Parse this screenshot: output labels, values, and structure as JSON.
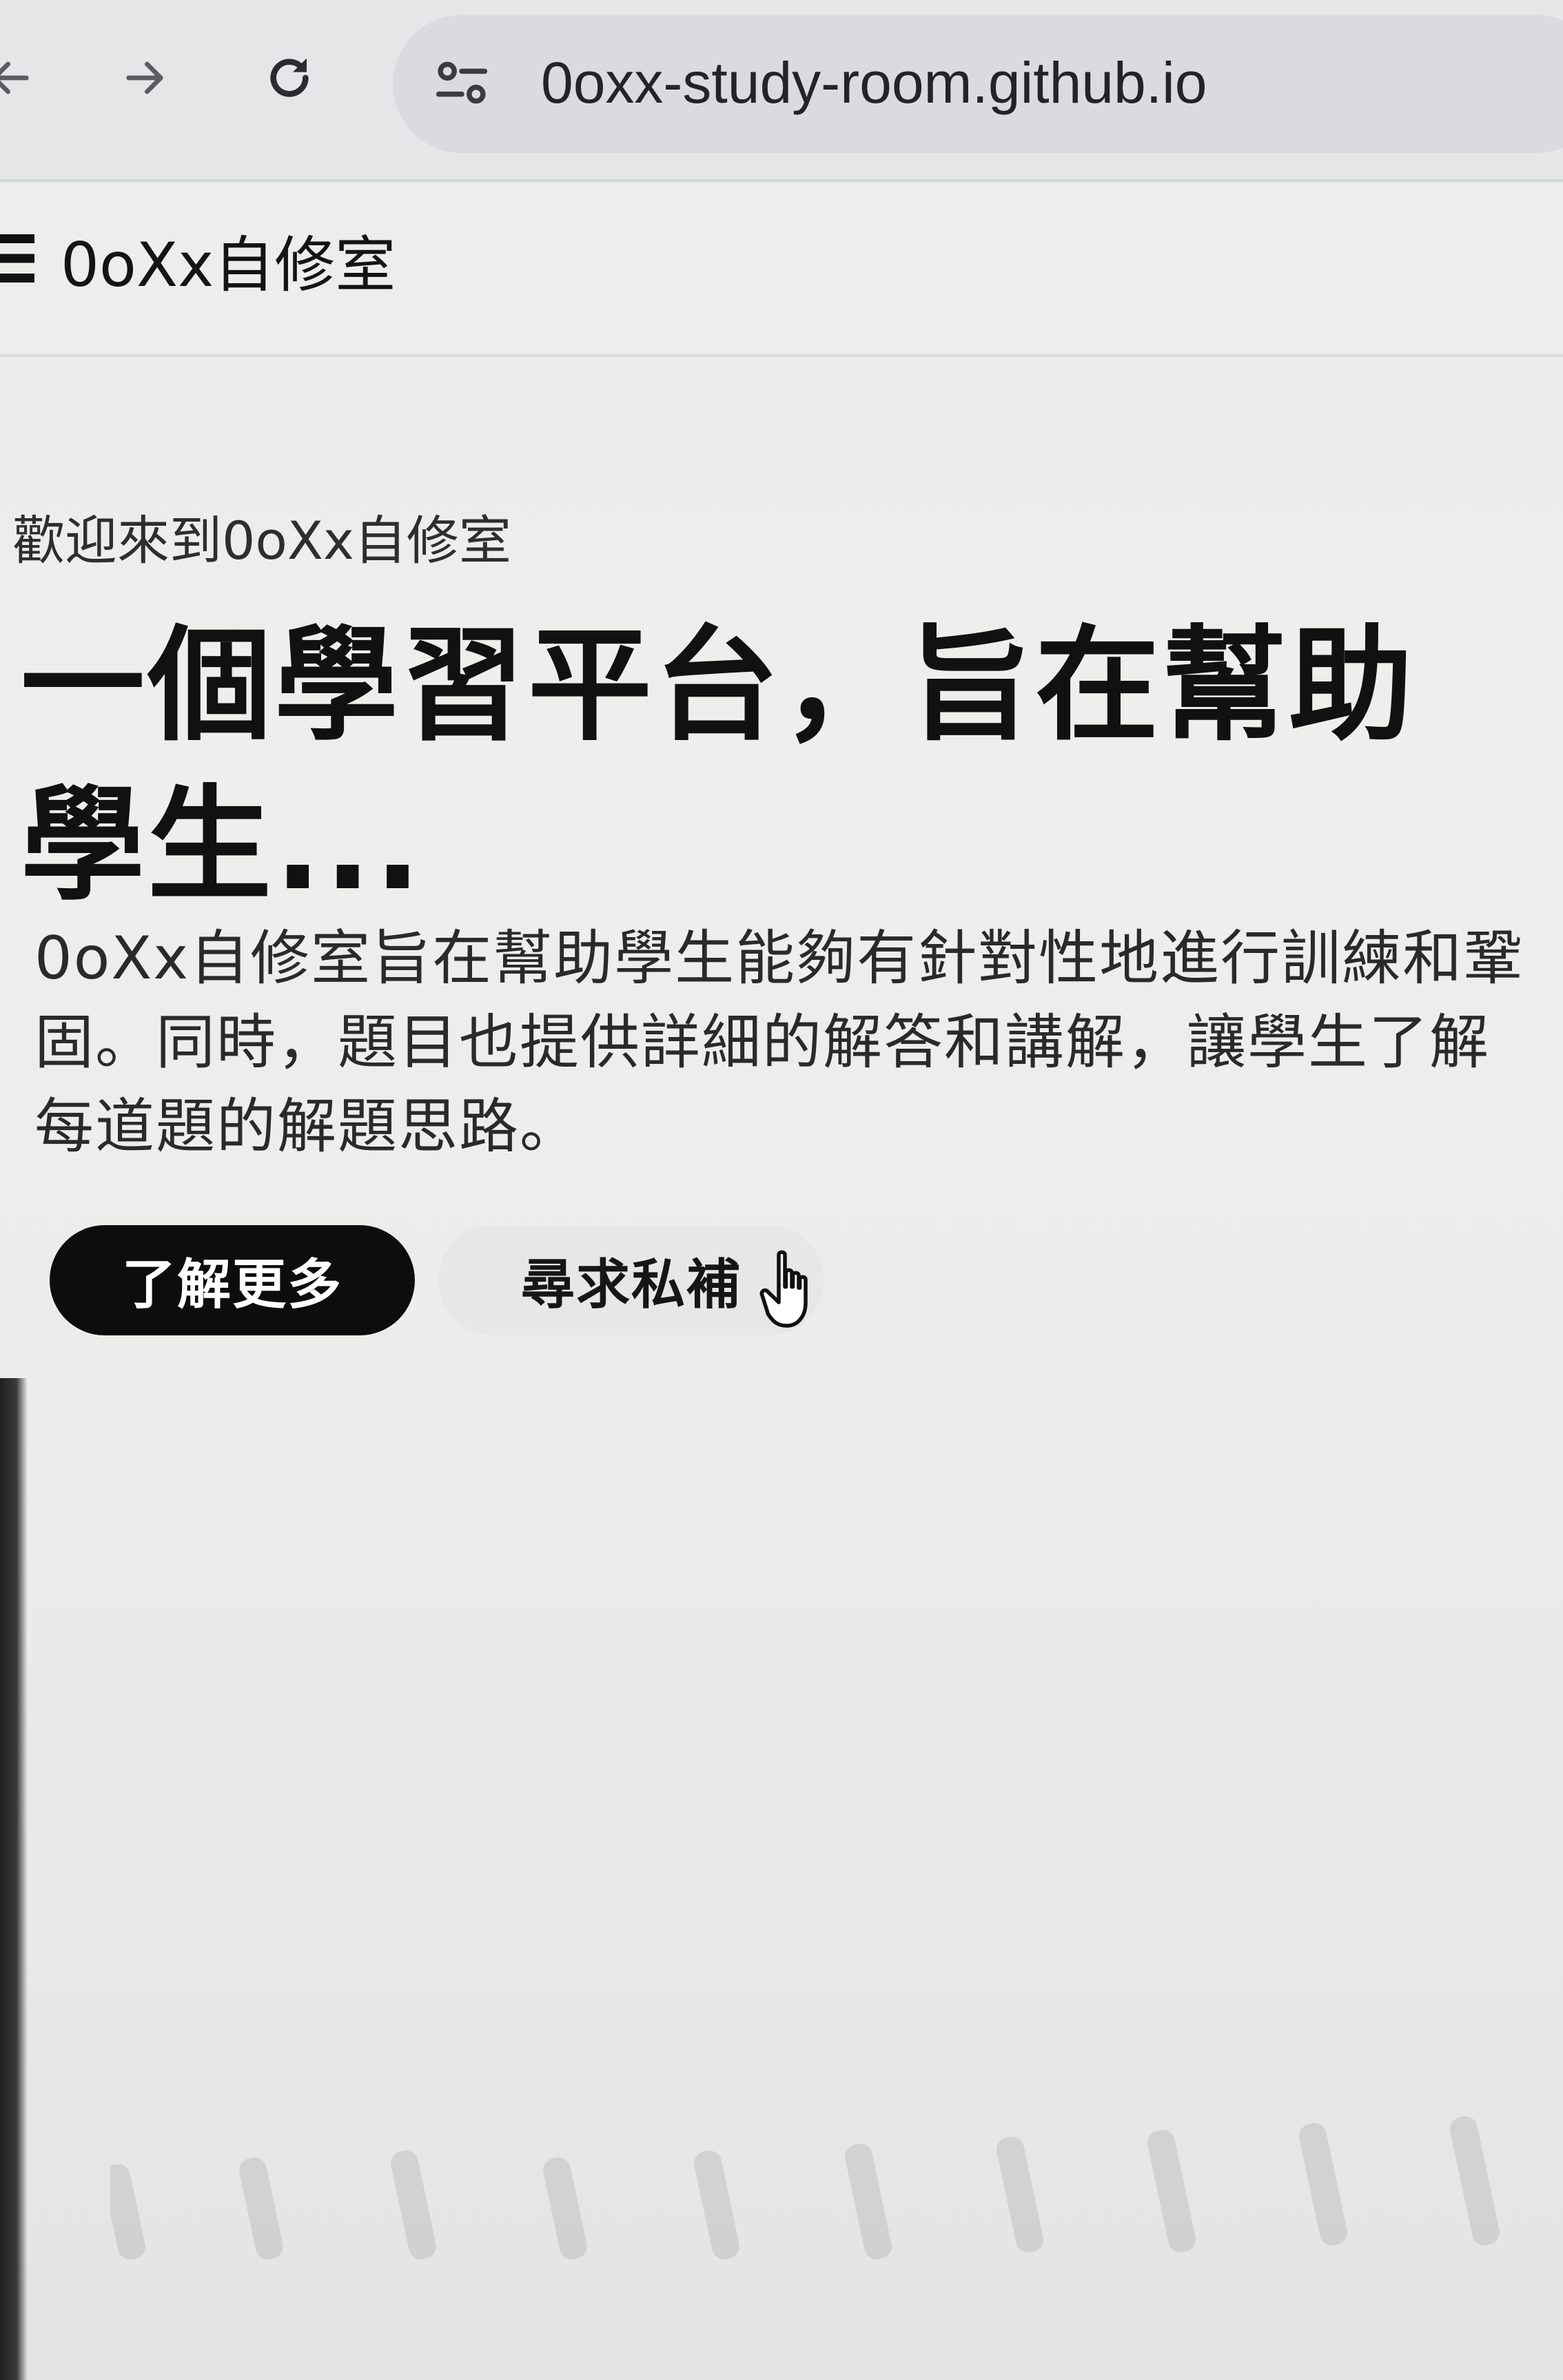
{
  "browser": {
    "url": "0oxx-study-room.github.io",
    "back_icon": "arrow-left-icon",
    "forward_icon": "arrow-right-icon",
    "reload_icon": "reload-icon",
    "site_info_icon": "tune-icon"
  },
  "header": {
    "menu_icon": "hamburger-menu-icon",
    "site_title": "0oXx自修室"
  },
  "hero": {
    "eyebrow": "歡迎來到0oXx自修室",
    "headline": "一個學習平台，旨在幫助學生...",
    "description": "0oXx自修室旨在幫助學生能夠有針對性地進行訓練和鞏固。同時，題目也提供詳細的解答和講解，讓學生了解每道題的解題思路。",
    "primary_button": "了解更多",
    "secondary_button": "尋求私補"
  },
  "colors": {
    "page_bg": "#ececea",
    "primary_button_bg": "#0d0d0d",
    "primary_button_text": "#ffffff",
    "secondary_button_bg": "#e7e7e5",
    "omnibox_bg": "#d9dbde"
  }
}
